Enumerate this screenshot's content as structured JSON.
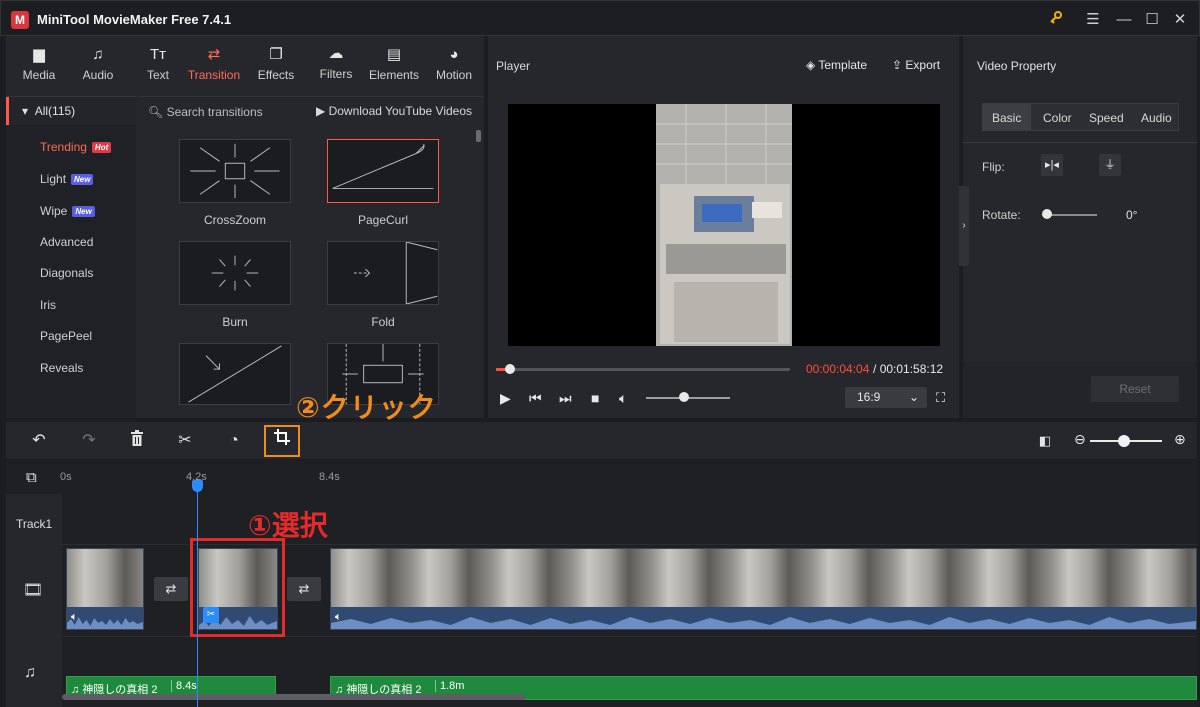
{
  "app": {
    "title": "MiniTool MovieMaker Free 7.4.1",
    "logo": "M"
  },
  "window": {
    "key_icon": "key-icon",
    "min": "—",
    "max": "☐",
    "close": "✕"
  },
  "tabs": [
    {
      "label": "Media",
      "icon": "folder-icon"
    },
    {
      "label": "Audio",
      "icon": "music-note-icon"
    },
    {
      "label": "Text",
      "icon": "text-icon"
    },
    {
      "label": "Transition",
      "icon": "transition-icon",
      "active": true
    },
    {
      "label": "Effects",
      "icon": "effects-icon"
    },
    {
      "label": "Filters",
      "icon": "filters-icon"
    },
    {
      "label": "Elements",
      "icon": "elements-icon"
    },
    {
      "label": "Motion",
      "icon": "motion-icon"
    }
  ],
  "categories": {
    "all": "All(115)",
    "items": [
      {
        "label": "Trending",
        "badge": "Hot"
      },
      {
        "label": "Light",
        "badge": "New"
      },
      {
        "label": "Wipe",
        "badge": "New"
      },
      {
        "label": "Advanced"
      },
      {
        "label": "Diagonals"
      },
      {
        "label": "Iris"
      },
      {
        "label": "PagePeel"
      },
      {
        "label": "Reveals"
      }
    ]
  },
  "transitions": {
    "search_placeholder": "Search transitions",
    "download_label": "Download YouTube Videos",
    "tiles": [
      {
        "label": "CrossZoom"
      },
      {
        "label": "PageCurl",
        "selected": true
      },
      {
        "label": "Burn"
      },
      {
        "label": "Fold"
      }
    ]
  },
  "player": {
    "label": "Player",
    "template_label": "Template",
    "export_label": "Export",
    "current_time": "00:00:04:04",
    "separator": "/",
    "total_time": "00:01:58:12",
    "aspect_ratio": "16:9",
    "progress_fraction": 0.035,
    "volume_fraction": 0.45
  },
  "property": {
    "title": "Video Property",
    "tabs": [
      "Basic",
      "Color",
      "Speed",
      "Audio"
    ],
    "flip_label": "Flip:",
    "rotate_label": "Rotate:",
    "rotate_value": "0°",
    "reset_label": "Reset"
  },
  "toolbar": {
    "undo": "↶",
    "redo": "↷",
    "delete": "🗑",
    "split": "✂",
    "speed": "◔",
    "crop": "⌗"
  },
  "annotations": {
    "click": "②クリック",
    "select": "①選択"
  },
  "timeline": {
    "ticks": [
      "0s",
      "4.2s",
      "8.4s"
    ],
    "track1": "Track1",
    "audio_clips": [
      {
        "name": "神隠しの真相 2",
        "duration": "8.4s"
      },
      {
        "name": "神隠しの真相 2",
        "duration": "1.8m"
      }
    ]
  }
}
